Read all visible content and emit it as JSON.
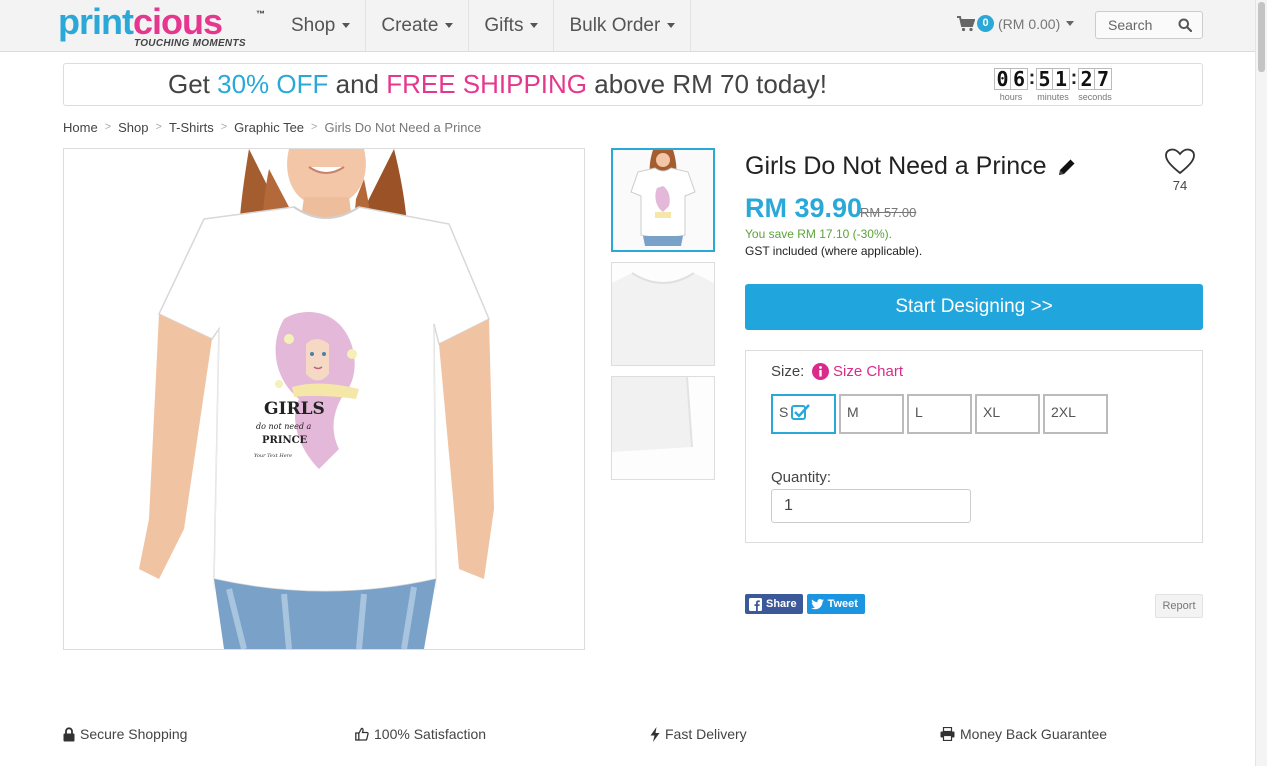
{
  "logo": {
    "text_part1": "print",
    "text_part2": "cious",
    "tm": "™",
    "tagline": "TOUCHING MOMENTS"
  },
  "nav": {
    "items": [
      {
        "label": "Shop"
      },
      {
        "label": "Create"
      },
      {
        "label": "Gifts"
      },
      {
        "label": "Bulk Order"
      }
    ]
  },
  "cart": {
    "count": "0",
    "total": "(RM 0.00)"
  },
  "search": {
    "placeholder": "Search"
  },
  "promo": {
    "pre": "Get ",
    "discount": "30% OFF",
    "mid": " and ",
    "shipping": "FREE SHIPPING",
    "post": " above RM 70 today!",
    "timer": {
      "hours": [
        "0",
        "6"
      ],
      "minutes": [
        "5",
        "1"
      ],
      "seconds": [
        "2",
        "7"
      ],
      "hours_label": "hours",
      "minutes_label": "minutes",
      "seconds_label": "seconds"
    }
  },
  "breadcrumb": {
    "items": [
      "Home",
      "Shop",
      "T-Shirts",
      "Graphic Tee"
    ],
    "current": "Girls Do Not Need a Prince",
    "separator": ">"
  },
  "product": {
    "title": "Girls Do Not Need a Prince",
    "price": "RM 39.90",
    "old_price": "RM 57.00",
    "savings": "You save RM 17.10 (-30%).",
    "gst": "GST included (where applicable).",
    "favorites": "74",
    "design_text": {
      "line1": "GIRLS",
      "line2": "do not need a",
      "line3": "PRINCE",
      "line4": "Your Text Here"
    }
  },
  "cta": {
    "start_designing": "Start Designing >>"
  },
  "options": {
    "size_label": "Size:",
    "size_chart": "Size Chart",
    "sizes": [
      "S",
      "M",
      "L",
      "XL",
      "2XL"
    ],
    "selected_size": "S",
    "quantity_label": "Quantity:",
    "quantity_value": "1"
  },
  "social": {
    "share": "Share",
    "tweet": "Tweet",
    "report": "Report"
  },
  "features": {
    "items": [
      "Secure Shopping",
      "100% Satisfaction",
      "Fast Delivery",
      "Money Back Guarantee"
    ]
  },
  "colors": {
    "brand_blue": "#2aa9d8",
    "brand_pink": "#e6378f",
    "savings_green": "#5aa33a",
    "cta_blue": "#20a6dc"
  }
}
